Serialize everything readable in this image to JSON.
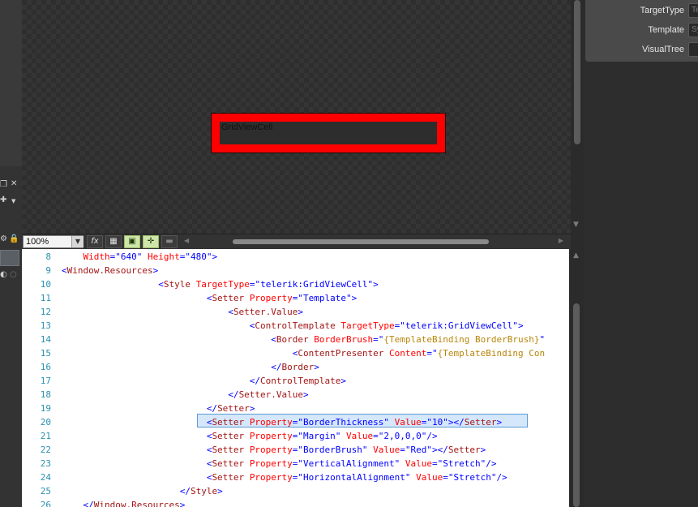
{
  "design_surface": {
    "cell_label": "GridViewCell"
  },
  "properties": [
    {
      "label": "TargetType",
      "value": "Te"
    },
    {
      "label": "Template",
      "value": "Sy"
    },
    {
      "label": "VisualTree",
      "value": ""
    }
  ],
  "toolbar": {
    "zoom_value": "100%",
    "fx_label": "fx"
  },
  "icons": {
    "zoom_dropdown": "chevron-down-icon",
    "pin": "pin-icon",
    "close": "close-icon",
    "grid": "grid-icon",
    "snap": "snap-to-grid-icon",
    "effects": "effects-icon",
    "annotation": "annotation-icon"
  },
  "colors": {
    "cell_border": "#ff0000",
    "xml_tag": "#a31515",
    "xml_attr": "#ff0000",
    "xml_value": "#0000ff",
    "xml_binding": "#b8860b",
    "line_number": "#2b91af",
    "highlight": "#d5e7fb"
  },
  "editor": {
    "highlighted_line": 20,
    "lines": [
      {
        "n": "8",
        "text": "    Width=\"640\" Height=\"480\">"
      },
      {
        "n": "9",
        "text": "<Window.Resources>"
      },
      {
        "n": "10",
        "text": "                  <Style TargetType=\"telerik:GridViewCell\">"
      },
      {
        "n": "11",
        "text": "                           <Setter Property=\"Template\">"
      },
      {
        "n": "12",
        "text": "                               <Setter.Value>"
      },
      {
        "n": "13",
        "text": "                                   <ControlTemplate TargetType=\"telerik:GridViewCell\">"
      },
      {
        "n": "14",
        "text": "                                       <Border BorderBrush=\"{TemplateBinding BorderBrush}\""
      },
      {
        "n": "15",
        "text": "                                           <ContentPresenter Content=\"{TemplateBinding Con"
      },
      {
        "n": "16",
        "text": "                                       </Border>"
      },
      {
        "n": "17",
        "text": "                                   </ControlTemplate>"
      },
      {
        "n": "18",
        "text": "                               </Setter.Value>"
      },
      {
        "n": "19",
        "text": "                           </Setter>"
      },
      {
        "n": "20",
        "text": "                           <Setter Property=\"BorderThickness\" Value=\"10\"></Setter>"
      },
      {
        "n": "21",
        "text": "                           <Setter Property=\"Margin\" Value=\"2,0,0,0\"/>"
      },
      {
        "n": "22",
        "text": "                           <Setter Property=\"BorderBrush\" Value=\"Red\"></Setter>"
      },
      {
        "n": "23",
        "text": "                           <Setter Property=\"VerticalAlignment\" Value=\"Stretch\"/>"
      },
      {
        "n": "24",
        "text": "                           <Setter Property=\"HorizontalAlignment\" Value=\"Stretch\"/>"
      },
      {
        "n": "25",
        "text": "                      </Style>"
      },
      {
        "n": "26",
        "text": "    </Window.Resources>"
      }
    ]
  }
}
